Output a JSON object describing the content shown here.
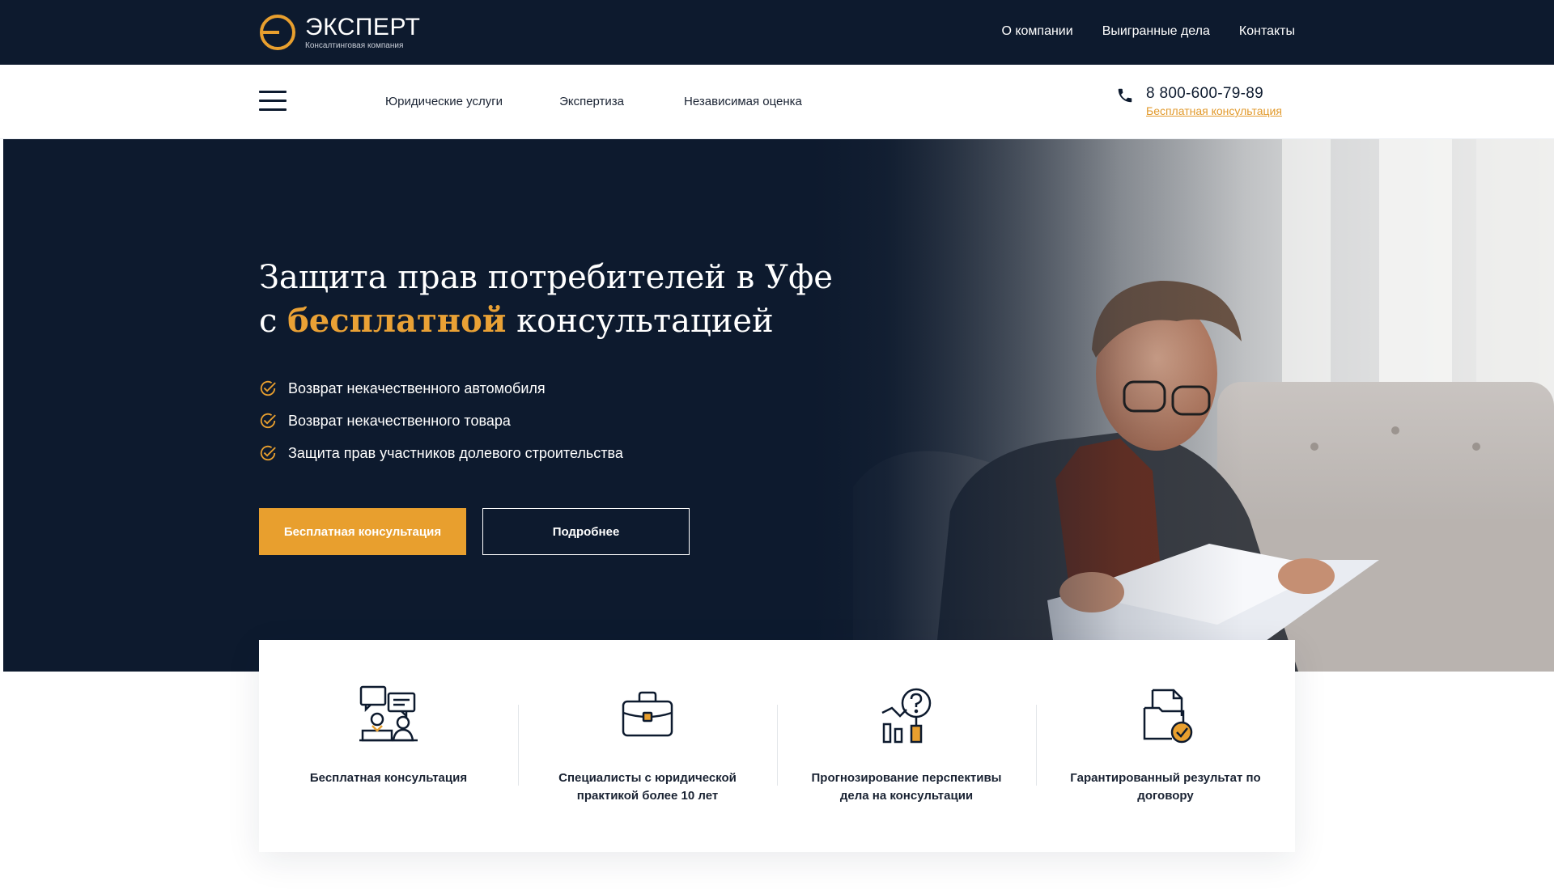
{
  "colors": {
    "navy": "#0d1a2e",
    "accent": "#e89f2e",
    "white": "#ffffff"
  },
  "brand": {
    "name": "ЭКСПЕРТ",
    "tagline": "Консалтинговая компания",
    "icon": "logo-circle-e-icon"
  },
  "top_nav": {
    "items": [
      {
        "label": "О компании"
      },
      {
        "label": "Выигранные дела"
      },
      {
        "label": "Контакты"
      }
    ]
  },
  "main_nav": {
    "menu_icon": "hamburger-menu-icon",
    "items": [
      {
        "label": "Юридические услуги"
      },
      {
        "label": "Экспертиза"
      },
      {
        "label": "Независимая оценка"
      }
    ]
  },
  "contact": {
    "phone": "8 800-600-79-89",
    "cta_link": "Бесплатная консультация",
    "icon": "phone-icon"
  },
  "hero": {
    "title_line1": "Защита прав потребителей в Уфе",
    "title_prefix": "с ",
    "title_accent": "бесплатной",
    "title_suffix": " консультацией",
    "bullets": [
      {
        "text": "Возврат некачественного автомобиля",
        "icon": "check-circle-icon"
      },
      {
        "text": "Возврат некачественного товара",
        "icon": "check-circle-icon"
      },
      {
        "text": "Защита прав участников долевого строительства",
        "icon": "check-circle-icon"
      }
    ],
    "primary_button": "Бесплатная консультация",
    "secondary_button": "Подробнее"
  },
  "features": [
    {
      "text": "Бесплатная консультация",
      "icon": "consultation-chat-icon"
    },
    {
      "text": "Специалисты с юридической практикой более 10 лет",
      "icon": "briefcase-icon"
    },
    {
      "text": "Прогнозирование перспективы дела на консультации",
      "icon": "analytics-question-icon"
    },
    {
      "text": "Гарантированный результат по договору",
      "icon": "document-check-icon"
    }
  ]
}
